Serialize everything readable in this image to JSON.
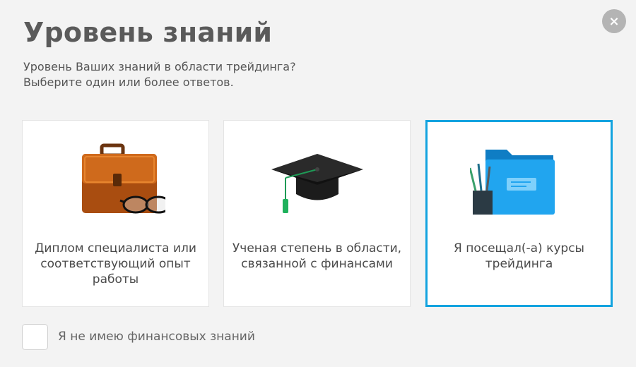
{
  "dialog": {
    "title": "Уровень знаний",
    "subtitle_line1": "Уровень Ваших знаний в области трейдинга?",
    "subtitle_line2": "Выберите один или более ответов.",
    "close_icon": "×"
  },
  "options": [
    {
      "label": "Диплом специалиста или соответствующий опыт работы",
      "icon": "briefcase-glasses-icon",
      "selected": false
    },
    {
      "label": "Ученая степень в области, связанной с финансами",
      "icon": "graduation-cap-icon",
      "selected": false
    },
    {
      "label": "Я посещал(-а) курсы трейдинга",
      "icon": "folder-pencils-icon",
      "selected": true
    }
  ],
  "no_knowledge": {
    "label": "Я не имею финансовых знаний",
    "checked": false
  },
  "colors": {
    "accent": "#13a3df",
    "title": "#5a5a5a",
    "background": "#f3f3f3"
  }
}
